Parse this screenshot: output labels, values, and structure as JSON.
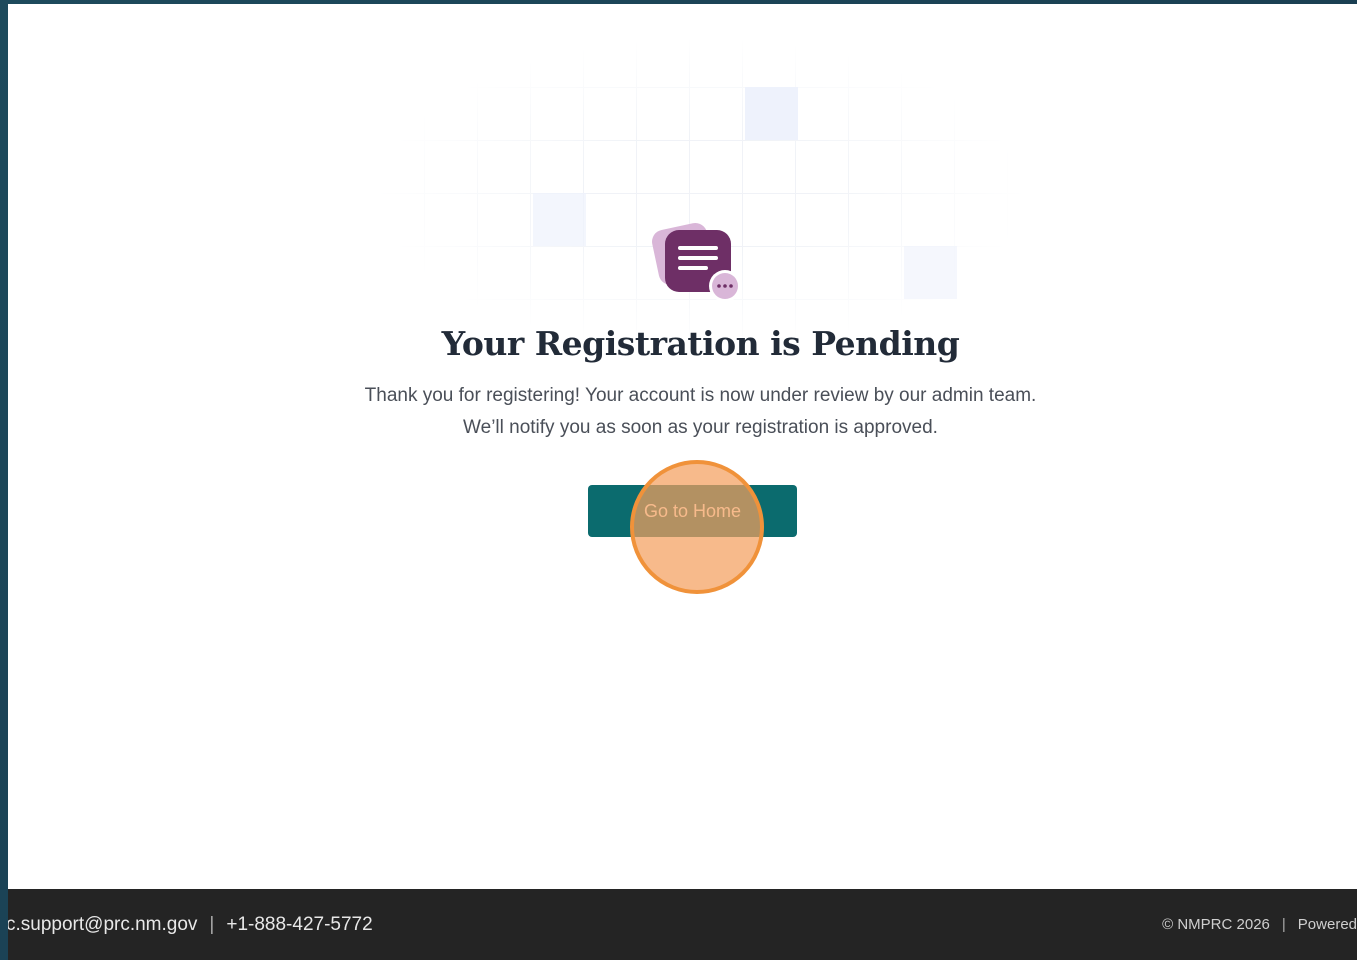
{
  "main": {
    "title": "Your Registration is Pending",
    "description_line1": "Thank you for registering! Your account is now under review by our admin team.",
    "description_line2": "We’ll notify you as soon as your registration is approved.",
    "home_button_label": "Go to Home",
    "icon": "pending-message-icon"
  },
  "footer": {
    "email": "c.support@prc.nm.gov",
    "separator": "|",
    "phone": "+1-888-427-5772",
    "copyright": "© NMPRC 2026",
    "powered": "Powered"
  },
  "colors": {
    "accent": "#0b6b6e",
    "icon_primary": "#6e2f66",
    "icon_secondary": "#d9b6d8",
    "footer_bg": "#242424",
    "click_marker": "#f0923a"
  }
}
